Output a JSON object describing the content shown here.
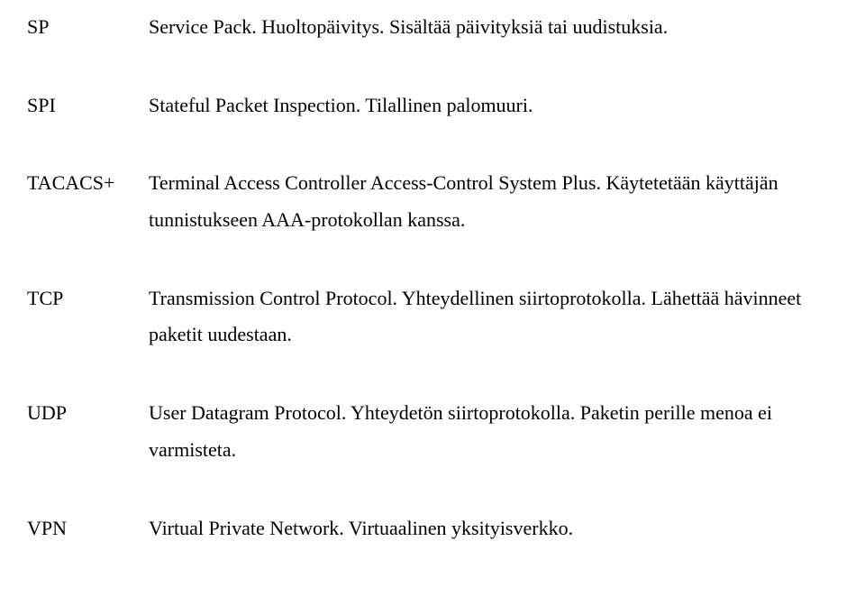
{
  "entries": [
    {
      "term": "SP",
      "definition": "Service Pack. Huoltopäivitys. Sisältää päivityksiä tai uudistuksia."
    },
    {
      "term": "SPI",
      "definition": "Stateful Packet Inspection. Tilallinen palomuuri."
    },
    {
      "term": "TACACS+",
      "definition": "Terminal Access Controller Access-Control System Plus. Käytetetään käyttäjän tunnistukseen AAA-protokollan kanssa."
    },
    {
      "term": "TCP",
      "definition": "Transmission Control Protocol. Yhteydellinen siirtoprotokolla. Lähettää hävinneet paketit uudestaan."
    },
    {
      "term": "UDP",
      "definition": "User Datagram Protocol. Yhteydetön siirtoprotokolla. Paketin perille menoa ei varmisteta."
    },
    {
      "term": "VPN",
      "definition": "Virtual Private Network. Virtuaalinen yksityisverkko."
    }
  ]
}
